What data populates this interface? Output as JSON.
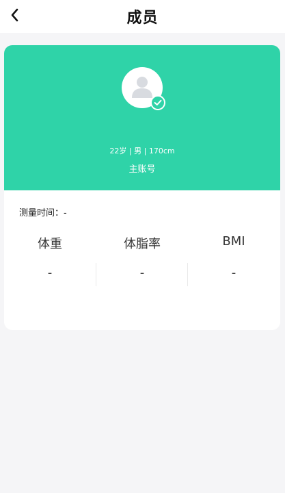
{
  "header": {
    "title": "成员",
    "back_icon": "chevron-left-icon"
  },
  "profile": {
    "avatar_icon": "user-avatar-icon",
    "badge_icon": "check-icon",
    "info": "22岁 | 男 | 170cm",
    "account_type": "主账号",
    "accent_color": "#2fd3a8"
  },
  "measurement": {
    "time_label": "测量时间：-",
    "metrics": [
      {
        "label": "体重",
        "value": "-"
      },
      {
        "label": "体脂率",
        "value": "-"
      },
      {
        "label": "BMI",
        "value": "-"
      }
    ]
  }
}
